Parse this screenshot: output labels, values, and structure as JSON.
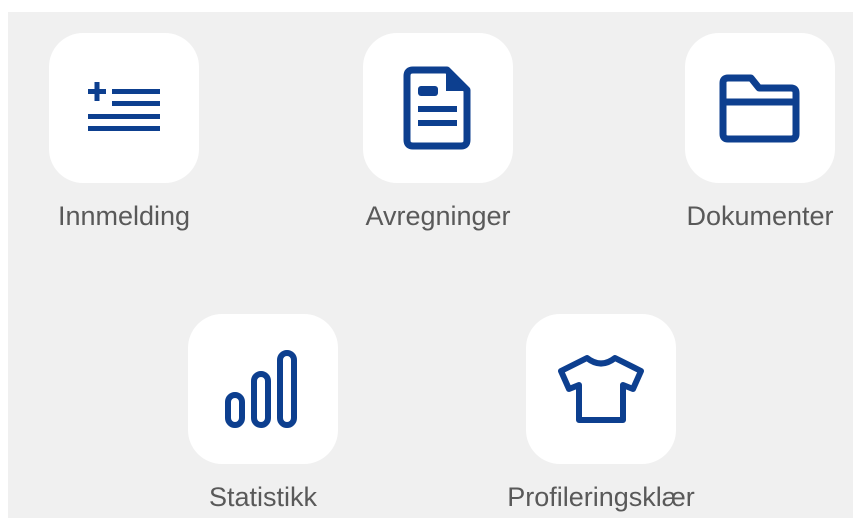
{
  "colors": {
    "accent": "#0d3f8f",
    "panel_bg": "#f0f0f0",
    "tile_bg": "#ffffff",
    "label_text": "#595959"
  },
  "menu": {
    "items": [
      {
        "label": "Innmelding",
        "icon": "add-list-icon"
      },
      {
        "label": "Avregninger",
        "icon": "document-icon"
      },
      {
        "label": "Dokumenter",
        "icon": "folder-icon"
      },
      {
        "label": "Statistikk",
        "icon": "bar-chart-icon"
      },
      {
        "label": "Profileringsklær",
        "icon": "t-shirt-icon"
      }
    ]
  }
}
